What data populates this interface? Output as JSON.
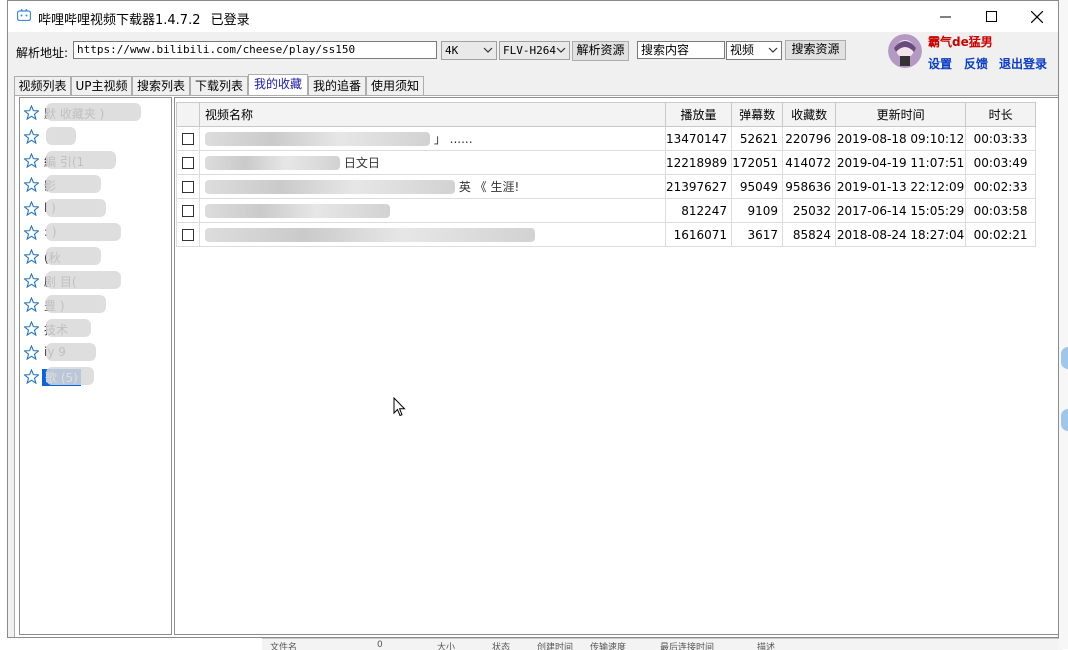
{
  "window": {
    "title": "哔哩哔哩视频下载器1.4.7.2",
    "login_status": "已登录"
  },
  "toolbar": {
    "url_label": "解析地址:",
    "url_value": "https://www.bilibili.com/cheese/play/ss150",
    "quality": "4K",
    "format": "FLV-H264",
    "parse_button": "解析资源",
    "search_placeholder": "搜索内容",
    "search_type": "视频",
    "search_button": "搜索资源"
  },
  "user": {
    "name": "霸气de猛男",
    "settings": "设置",
    "feedback": "反馈",
    "logout": "退出登录"
  },
  "tabs": [
    "视频列表",
    "UP主视频",
    "搜索列表",
    "下载列表",
    "我的收藏",
    "我的追番",
    "使用须知"
  ],
  "active_tab": "我的收藏",
  "favorites": [
    {
      "label": "默  收藏夹  )"
    },
    {
      "label": ""
    },
    {
      "label": "編    引(1"
    },
    {
      "label": "影"
    },
    {
      "label": "l       )"
    },
    {
      "label": ":        )"
    },
    {
      "label": "(秋"
    },
    {
      "label": "剧    目("
    },
    {
      "label": "豊       )"
    },
    {
      "label": "技术"
    },
    {
      "label": " iy  9"
    },
    {
      "label": "歌  (5)"
    }
  ],
  "table": {
    "columns": [
      "视频名称",
      "播放量",
      "弹幕数",
      "收藏数",
      "更新时间",
      "时长"
    ],
    "rows": [
      {
        "name": "」  ...... ",
        "plays": "13470147",
        "danmaku": "52621",
        "favorites": "220796",
        "updated": "2019-08-18 09:10:12",
        "duration": "00:03:33"
      },
      {
        "name": "日文日",
        "plays": "12218989",
        "danmaku": "172051",
        "favorites": "414072",
        "updated": "2019-04-19 11:07:51",
        "duration": "00:03:49"
      },
      {
        "name": "英  《   生涯!",
        "plays": "21397627",
        "danmaku": "95049",
        "favorites": "958636",
        "updated": "2019-01-13 22:12:09",
        "duration": "00:02:33"
      },
      {
        "name": "",
        "plays": "812247",
        "danmaku": "9109",
        "favorites": "25032",
        "updated": "2017-06-14 15:05:29",
        "duration": "00:03:58"
      },
      {
        "name": "",
        "plays": "1616071",
        "danmaku": "3617",
        "favorites": "85824",
        "updated": "2018-08-24 18:27:04",
        "duration": "00:02:21"
      }
    ]
  },
  "background_window": {
    "columns": [
      "文件名",
      "0",
      "大小",
      "状态",
      "创建时间",
      "传输速度",
      "最后连接时间",
      "描述"
    ]
  },
  "colors": {
    "accent_blue": "#0a64d8",
    "user_red": "#cc0000",
    "link_blue": "#0a3cc8"
  }
}
